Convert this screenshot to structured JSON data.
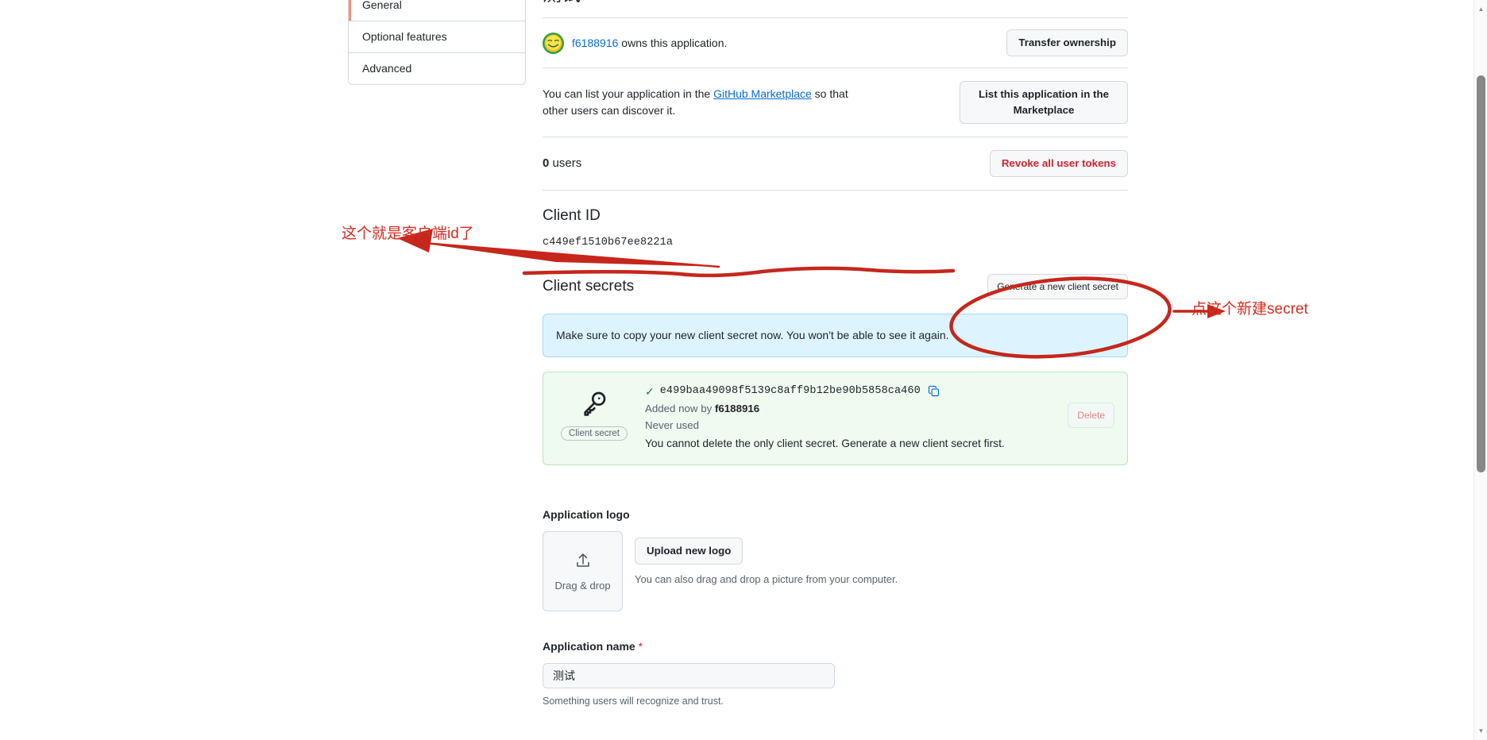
{
  "sidebar": {
    "items": [
      {
        "label": "General",
        "active": true
      },
      {
        "label": "Optional features",
        "active": false
      },
      {
        "label": "Advanced",
        "active": false
      }
    ]
  },
  "main": {
    "page_title": "测试",
    "owner": {
      "username": "f6188916",
      "suffix_text": " owns this application.",
      "transfer_button": "Transfer ownership"
    },
    "marketplace": {
      "text_before": "You can list your application in the ",
      "link_text": "GitHub Marketplace",
      "text_after": " so that other users can discover it.",
      "button": "List this application in the Marketplace"
    },
    "users": {
      "count": "0",
      "label": " users",
      "revoke_button": "Revoke all user tokens"
    },
    "client_id": {
      "heading": "Client ID",
      "value": "c449ef1510b67ee8221a"
    },
    "client_secrets": {
      "heading": "Client secrets",
      "generate_button": "Generate a new client secret",
      "flash_message": "Make sure to copy your new client secret now. You won't be able to see it again.",
      "secret": {
        "badge": "Client secret",
        "value": "e499baa49098f5139c8aff9b12be90b5858ca460",
        "added_prefix": "Added now by ",
        "added_by": "f6188916",
        "last_used": "Never used",
        "delete_note": "You cannot delete the only client secret. Generate a new client secret first.",
        "delete_button": "Delete"
      }
    },
    "application_logo": {
      "label": "Application logo",
      "dropzone_text": "Drag & drop",
      "upload_button": "Upload new logo",
      "hint": "You can also drag and drop a picture from your computer."
    },
    "application_name": {
      "label": "Application name",
      "required_marker": "*",
      "value": "测试",
      "placeholder": "Application name",
      "hint": "Something users will recognize and trust."
    }
  },
  "annotations": {
    "left_note": "这个就是客户端id了",
    "right_note": "点这个新建secret",
    "color": "#d62b1f"
  },
  "colors": {
    "accent_link": "#0969da",
    "danger": "#cf222e",
    "active_border": "#fd8c73",
    "flash_bg": "#ddf4ff",
    "secret_bg": "#effaf1",
    "success": "#1a7f37"
  }
}
